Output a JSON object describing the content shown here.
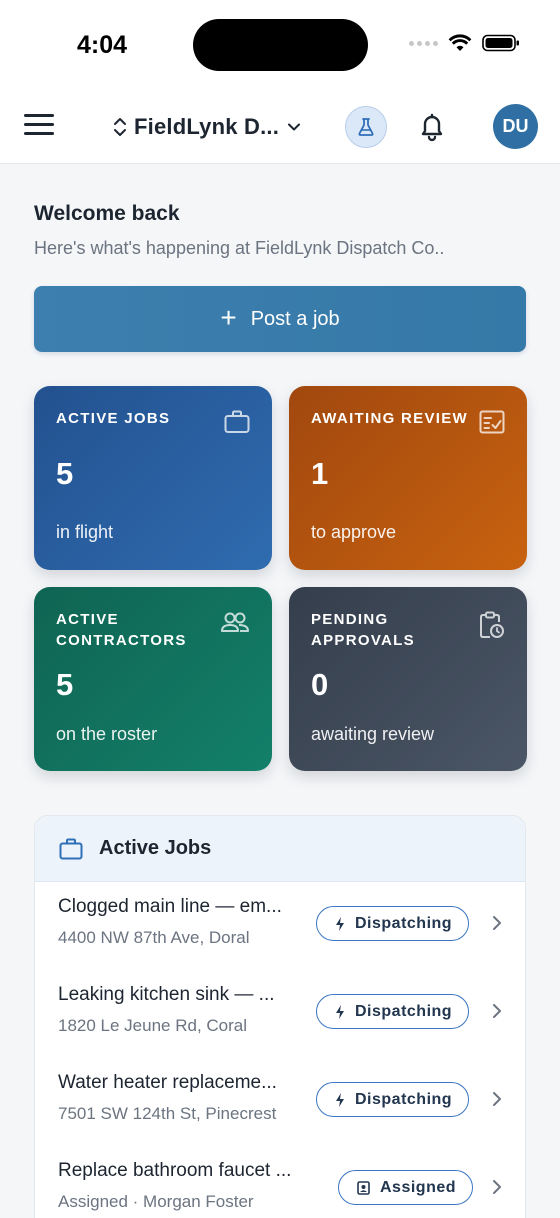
{
  "status_bar": {
    "time": "4:04"
  },
  "header": {
    "org_name": "FieldLynk D...",
    "avatar_initials": "DU"
  },
  "welcome": {
    "title": "Welcome back",
    "subtitle": "Here's what's happening at FieldLynk Dispatch Co.."
  },
  "post_job": {
    "label": "Post a job"
  },
  "stats": [
    {
      "label": "ACTIVE JOBS",
      "value": "5",
      "foot": "in flight",
      "icon": "briefcase-icon",
      "color": "#2a5fa0"
    },
    {
      "label": "AWAITING REVIEW",
      "value": "1",
      "foot": "to approve",
      "icon": "review-checklist-icon",
      "color": "#b5550f"
    },
    {
      "label": "ACTIVE CONTRACTORS",
      "value": "5",
      "foot": "on the roster",
      "icon": "users-icon",
      "color": "#11735e"
    },
    {
      "label": "PENDING APPROVALS",
      "value": "0",
      "foot": "awaiting review",
      "icon": "clipboard-clock-icon",
      "color": "#3f4958"
    }
  ],
  "active_jobs": {
    "title": "Active Jobs",
    "rows": [
      {
        "title": "Clogged main line — em...",
        "sub": "4400 NW 87th Ave, Doral",
        "status": "Dispatching"
      },
      {
        "title": "Leaking kitchen sink — ...",
        "sub": "1820 Le Jeune Rd, Coral",
        "status": "Dispatching"
      },
      {
        "title": "Water heater replaceme...",
        "sub": "7501 SW 124th St, Pinecrest",
        "status": "Dispatching"
      },
      {
        "title": "Replace bathroom faucet ...",
        "sub": "Assigned · Morgan Foster",
        "status": "Assigned"
      }
    ]
  }
}
